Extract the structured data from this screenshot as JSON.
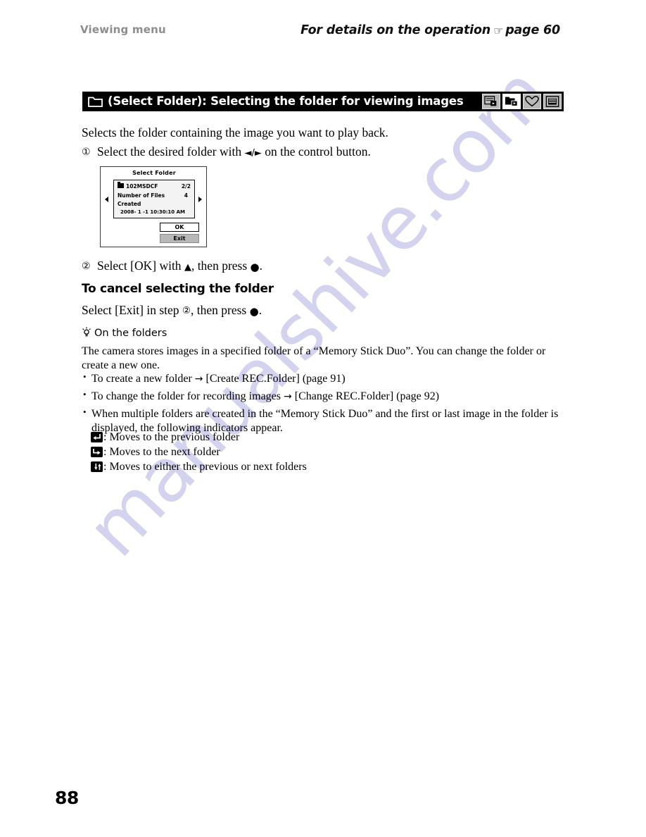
{
  "header": {
    "left_title": "Viewing menu",
    "right_note_before": "For details on the operation",
    "hand_icon": "pointing-hand-icon",
    "right_note_after": "page 60"
  },
  "section": {
    "folder_icon": "folder-icon",
    "title": "(Select Folder): Selecting the folder for viewing images",
    "mode_icons": [
      {
        "name": "slideshow-icon",
        "active": false
      },
      {
        "name": "select-folder-icon",
        "active": true
      },
      {
        "name": "favorites-heart-icon",
        "active": false
      },
      {
        "name": "display-frame-icon",
        "active": false
      }
    ]
  },
  "body": {
    "intro": "Selects the folder containing the image you want to play back.",
    "step1_num": "①",
    "step1_text_a": "Select the desired folder with ",
    "step1_glyph": "◄/►",
    "step1_text_b": " on the control button.",
    "step2_num": "②",
    "step2_text_a": "Select [OK] with ",
    "step2_glyph": "▲",
    "step2_text_b": ", then press ",
    "step2_dot": "●",
    "step2_end": ".",
    "cancel_heading": "To cancel selecting the folder",
    "cancel_text_a": "Select [Exit] in step ",
    "cancel_step": "②",
    "cancel_text_b": ", then press ",
    "cancel_dot": "●",
    "cancel_end": "."
  },
  "lcd": {
    "title": "Select Folder",
    "folder_name": "102MSDCF",
    "folder_index": "2/2",
    "files_label": "Number of Files",
    "files_value": "4",
    "created_label": "Created",
    "created_value": "2008-  1  -1   10:30:10 AM",
    "button_ok": "OK",
    "button_exit": "Exit",
    "arrow_left": "prev-folder-arrow",
    "arrow_right": "next-folder-arrow"
  },
  "tip": {
    "bulb_icon": "lightbulb-icon",
    "heading": "On the folders",
    "paragraph": "The camera stores images in a specified folder of a “Memory Stick Duo”. You can change the folder or create a new one.",
    "bullets": [
      {
        "text_a": "To create a new folder ",
        "arrow": "→",
        "text_b": " [Create REC.Folder] (page 91)"
      },
      {
        "text_a": "To change the folder for recording images ",
        "arrow": "→",
        "text_b": " [Change REC.Folder] (page 92)"
      },
      {
        "text_a": "When multiple folders are created in the “Memory Stick Duo” and the first or last image in the folder is displayed, the following indicators appear.",
        "arrow": "",
        "text_b": ""
      }
    ],
    "indicators": [
      {
        "icon": "move-previous-folder-icon",
        "label": ": Moves to the previous folder"
      },
      {
        "icon": "move-next-folder-icon",
        "label": ": Moves to the next folder"
      },
      {
        "icon": "move-either-folder-icon",
        "label": ": Moves to either the previous or next folders"
      }
    ]
  },
  "footer": {
    "page_number": "88"
  },
  "watermark": {
    "text": "manualshive.com",
    "color": "#ccccee"
  }
}
